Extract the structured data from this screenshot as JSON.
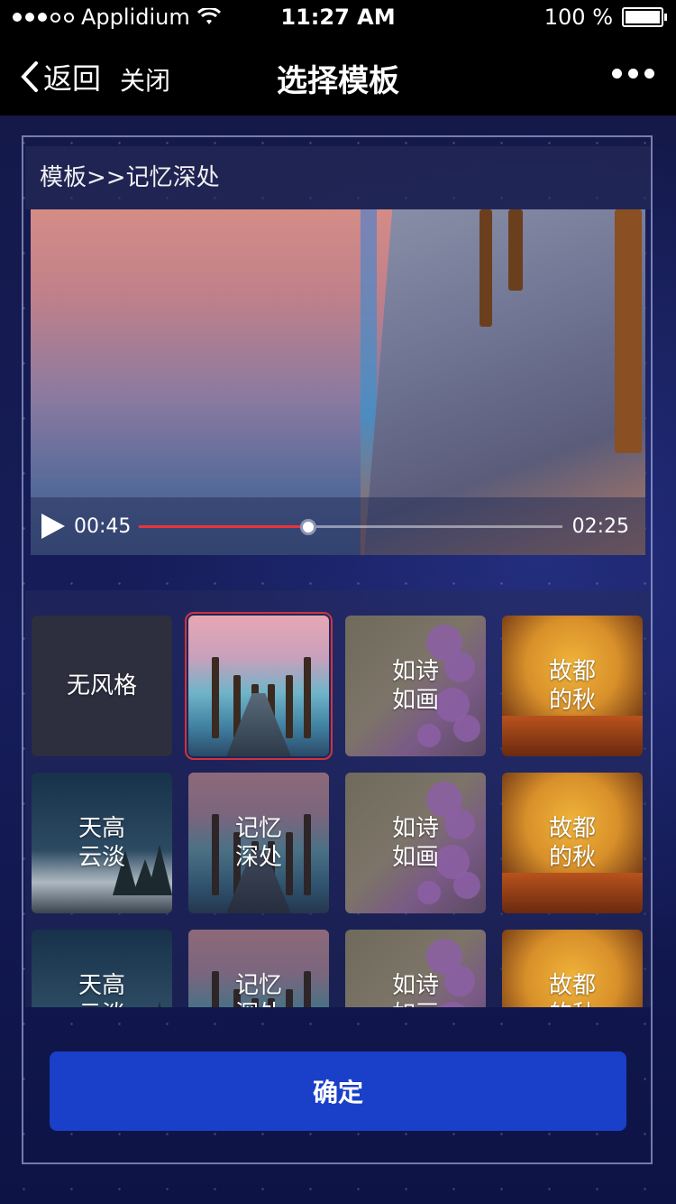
{
  "status_bar": {
    "carrier": "Applidium",
    "time": "11:27 AM",
    "battery": "100 %"
  },
  "nav": {
    "back_label": "返回",
    "close_label": "关闭",
    "title": "选择模板"
  },
  "breadcrumb": "模板>>记忆深处",
  "player": {
    "current_time": "00:45",
    "total_time": "02:25",
    "progress": 0.4
  },
  "templates": [
    {
      "label": "无风格",
      "style": "none",
      "selected": false
    },
    {
      "label": "",
      "style": "mem",
      "selected": true
    },
    {
      "label": "如诗\n如画",
      "style": "poem",
      "selected": false
    },
    {
      "label": "故都\n的秋",
      "style": "autumn",
      "selected": false
    },
    {
      "label": "天高\n云淡",
      "style": "sky",
      "selected": false
    },
    {
      "label": "记忆\n深处",
      "style": "mem",
      "selected": false
    },
    {
      "label": "如诗\n如画",
      "style": "poem",
      "selected": false
    },
    {
      "label": "故都\n的秋",
      "style": "autumn",
      "selected": false
    },
    {
      "label": "天高\n云淡",
      "style": "sky",
      "selected": false
    },
    {
      "label": "记忆\n深处",
      "style": "mem",
      "selected": false
    },
    {
      "label": "如诗\n如画",
      "style": "poem",
      "selected": false
    },
    {
      "label": "故都\n的秋",
      "style": "autumn",
      "selected": false
    }
  ],
  "confirm_label": "确定",
  "colors": {
    "accent_button": "#1a3fc8",
    "progress": "#e8353b",
    "selected_outline": "#d0343c"
  },
  "icons": {
    "back": "chevron-left-icon",
    "more": "more-dots-icon",
    "play": "play-icon",
    "wifi": "wifi-icon",
    "battery": "battery-icon"
  }
}
